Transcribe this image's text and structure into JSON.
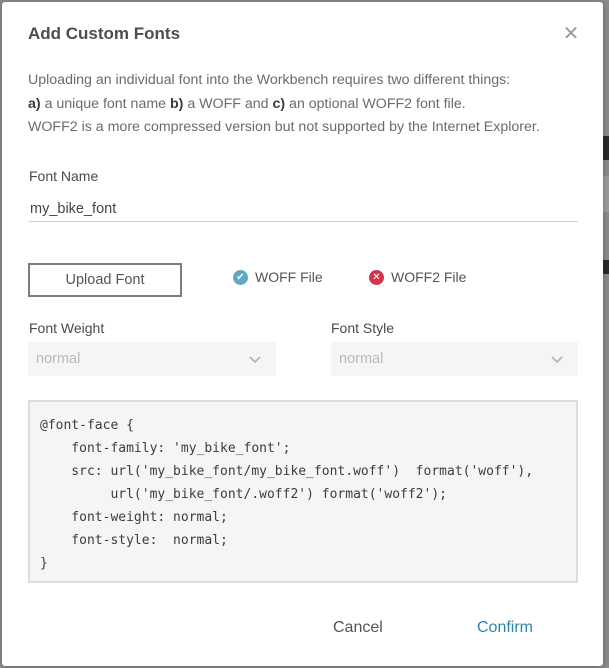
{
  "dialog": {
    "title": "Add Custom Fonts",
    "close_icon": "close-icon",
    "description": {
      "line1": "Uploading an individual font into the Workbench requires two different things:",
      "line2_a": "a)",
      "line2_b": " a unique font name ",
      "line2_c": "b)",
      "line2_d": " a WOFF and ",
      "line2_e": "c)",
      "line2_f": " an optional WOFF2 font file.",
      "line3": "WOFF2 is a more compressed version but not supported by the Internet Explorer."
    },
    "font_name": {
      "label": "Font Name",
      "value": "my_bike_font"
    },
    "upload": {
      "button_label": "Upload Font",
      "woff_status": "WOFF File",
      "woff_icon": "check-circle-icon",
      "woff_color": "#5fa8c7",
      "woff2_status": "WOFF2 File",
      "woff2_icon": "x-circle-icon",
      "woff2_color": "#d8334a"
    },
    "font_weight": {
      "label": "Font Weight",
      "value": "normal"
    },
    "font_style": {
      "label": "Font Style",
      "value": "normal"
    },
    "code_preview": "@font-face {\n    font-family: 'my_bike_font';\n    src: url('my_bike_font/my_bike_font.woff')  format('woff'),\n         url('my_bike_font/.woff2') format('woff2');\n    font-weight: normal;\n    font-style:  normal;\n}",
    "actions": {
      "cancel_label": "Cancel",
      "confirm_label": "Confirm",
      "confirm_color": "#2c86ad"
    }
  }
}
